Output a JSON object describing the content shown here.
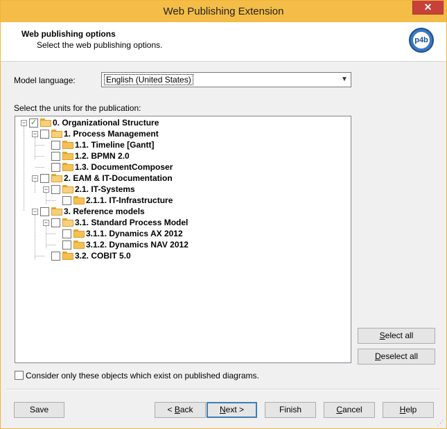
{
  "window": {
    "title": "Web Publishing Extension",
    "close_label": "✕"
  },
  "header": {
    "title": "Web publishing options",
    "subtitle": "Select the web publishing options.",
    "logo_text": "p4b"
  },
  "model_language": {
    "label": "Model language:",
    "value": "English (United States)"
  },
  "tree_label": "Select the units for the publication:",
  "tree": {
    "items": [
      {
        "label": "0. Organizational Structure",
        "checked": true,
        "expanded": true
      },
      {
        "label": "1. Process Management",
        "checked": false,
        "expanded": true
      },
      {
        "label": "1.1. Timeline [Gantt]",
        "checked": false
      },
      {
        "label": "1.2. BPMN 2.0",
        "checked": false
      },
      {
        "label": "1.3. DocumentComposer",
        "checked": false
      },
      {
        "label": "2. EAM & IT-Documentation",
        "checked": false,
        "expanded": true
      },
      {
        "label": "2.1. IT-Systems",
        "checked": false,
        "expanded": true
      },
      {
        "label": "2.1.1. IT-Infrastructure",
        "checked": false
      },
      {
        "label": "3. Reference models",
        "checked": false,
        "expanded": true
      },
      {
        "label": "3.1. Standard Process Model",
        "checked": false,
        "expanded": true
      },
      {
        "label": "3.1.1. Dynamics AX 2012",
        "checked": false
      },
      {
        "label": "3.1.2. Dynamics NAV 2012",
        "checked": false
      },
      {
        "label": "3.2. COBIT 5.0",
        "checked": false
      }
    ]
  },
  "buttons": {
    "select_all": {
      "pre": "",
      "key": "S",
      "post": "elect all"
    },
    "deselect_all": {
      "pre": "",
      "key": "D",
      "post": "eselect all"
    },
    "save": "Save",
    "back": {
      "pre": "< ",
      "key": "B",
      "post": "ack"
    },
    "next": {
      "pre": "",
      "key": "N",
      "post": "ext >"
    },
    "finish": "Finish",
    "cancel": {
      "pre": "",
      "key": "C",
      "post": "ancel"
    },
    "help": {
      "pre": "",
      "key": "H",
      "post": "elp"
    }
  },
  "consider_only": {
    "label": "Consider only these objects which exist on published diagrams.",
    "checked": false
  },
  "colors": {
    "title_bar": "#f4bd47",
    "folder": "#f6c052",
    "check_green": "#3e8f3e",
    "default_button_border": "#3c7fb1"
  }
}
